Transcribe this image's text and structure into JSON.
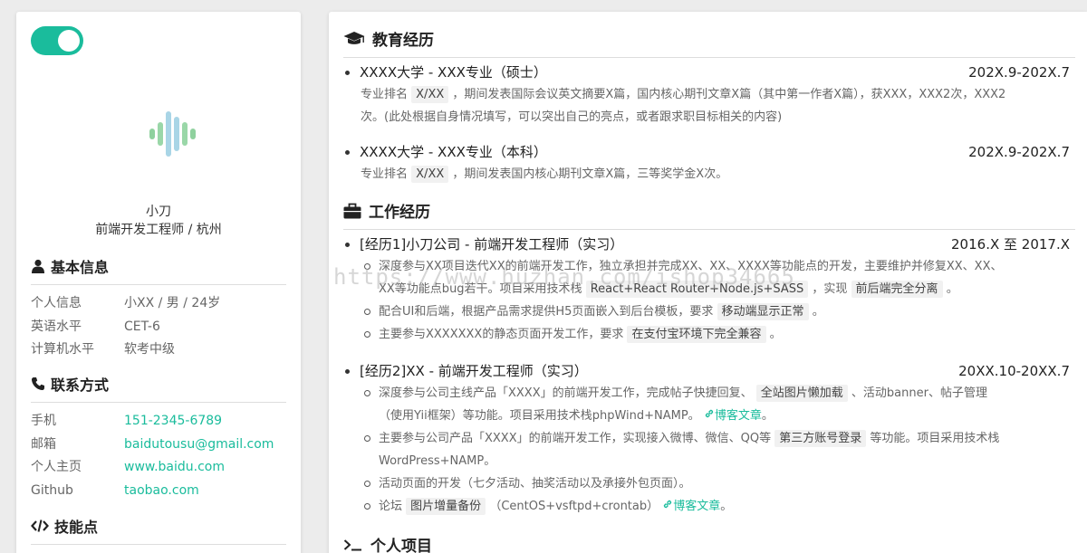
{
  "profile": {
    "name": "小刀",
    "subtitle": "前端开发工程师 / 杭州"
  },
  "basic": {
    "title": "基本信息",
    "rows": [
      {
        "k": "个人信息",
        "v": "小XX / 男 / 24岁"
      },
      {
        "k": "英语水平",
        "v": "CET-6"
      },
      {
        "k": "计算机水平",
        "v": "软考中级"
      }
    ]
  },
  "contact": {
    "title": "联系方式",
    "rows": [
      {
        "k": "手机",
        "v": "151-2345-6789"
      },
      {
        "k": "邮箱",
        "v": "baidutousu@gmail.com"
      },
      {
        "k": "个人主页",
        "v": "www.baidu.com"
      },
      {
        "k": "Github",
        "v": "taobao.com"
      }
    ]
  },
  "skills": {
    "title": "技能点"
  },
  "education": {
    "title": "教育经历",
    "items": [
      {
        "head": "XXXX大学 - XXX专业（硕士）",
        "date": "202X.9-202X.7",
        "d1": "专业排名",
        "tag": "X/XX",
        "d2": "，期间发表国际会议英文摘要X篇，国内核心期刊文章X篇（其中第一作者X篇），获XXX，XXX2次，XXX2",
        "d3": "次。(此处根据自身情况填写，可以突出自己的亮点，或者跟求职目标相关的内容)"
      },
      {
        "head": "XXXX大学 - XXX专业（本科）",
        "date": "202X.9-202X.7",
        "d1": "专业排名",
        "tag": "X/XX",
        "d2": "，期间发表国内核心期刊文章X篇，三等奖学金X次。"
      }
    ]
  },
  "work": {
    "title": "工作经历",
    "items": [
      {
        "head": "[经历1]小刀公司 - 前端开发工程师（实习）",
        "date": "2016.X 至 2017.X",
        "b1a": "深度参与XX项目迭代XX的前端开发工作，独立承担并完成XX、XX、XXXX等功能点的开发，主要维护并修复XX、XX、",
        "b1b": "XX等功能点bug若干。项目采用技术栈",
        "b1tag1": "React+React Router+Node.js+SASS",
        "b1c": "，实现",
        "b1tag2": "前后端完全分离",
        "b1d": "。",
        "b2a": "配合UI和后端，根据产品需求提供H5页面嵌入到后台模板，要求",
        "b2tag": "移动端显示正常",
        "b2b": "。",
        "b3a": "主要参与XXXXXXX的静态页面开发工作，要求",
        "b3tag": "在支付宝环境下完全兼容",
        "b3b": "。"
      },
      {
        "head": "[经历2]XX - 前端开发工程师（实习）",
        "date": "20XX.10-20XX.7",
        "b1a": "深度参与公司主线产品「XXXX」的前端开发工作，完成帖子快捷回复、",
        "b1tag": "全站图片懒加载",
        "b1b": "、活动banner、帖子管理",
        "b1c": "（使用Yii框架）等功能。项目采用技术栈phpWind+NAMP。",
        "blog": "博客文章",
        "b2a": "主要参与公司产品「XXXX」的前端开发工作，实现接入微博、微信、QQ等",
        "b2tag": "第三方账号登录",
        "b2b": "等功能。项目采用技术栈",
        "b2c": "WordPress+NAMP。",
        "b3": "活动页面的开发（七夕活动、抽奖活动以及承接外包页面）。",
        "b4a": "论坛",
        "b4tag": "图片增量备份",
        "b4b": "（CentOS+vsftpd+crontab）"
      }
    ]
  },
  "project": {
    "title": "个人项目"
  },
  "watermark": "https://www.huzhan.com/ishop34665",
  "colors": {
    "accent": "#1abc9c"
  },
  "icons": [
    "user-icon",
    "phone-icon",
    "code-icon",
    "graduation-cap-icon",
    "briefcase-icon",
    "terminal-icon",
    "link-icon"
  ]
}
